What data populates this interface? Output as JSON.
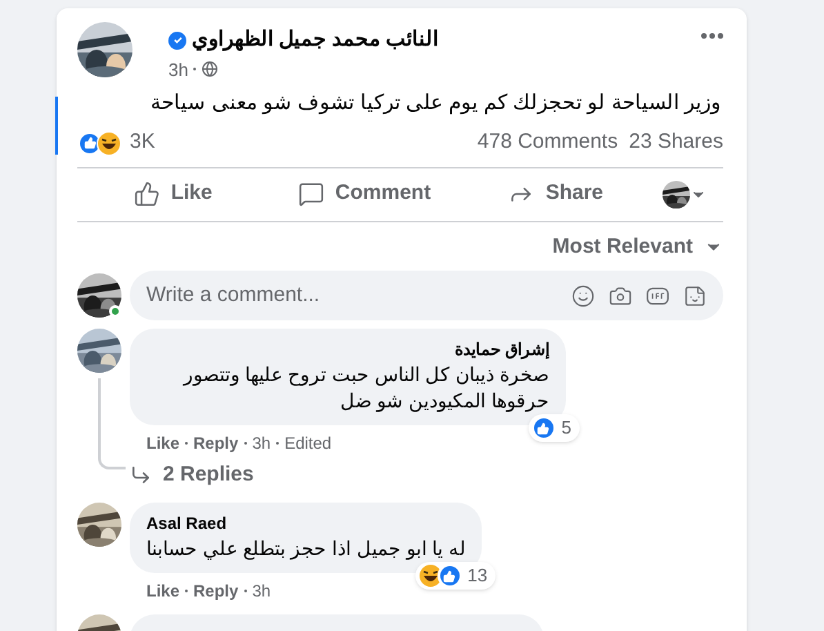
{
  "post": {
    "author": "النائب محمد جميل الظهراوي",
    "verified": true,
    "time": "3h",
    "text": "وزير السياحة  لو تحجزلك كم يوم على تركيا تشوف شو معنى سياحة",
    "reactions": [
      {
        "kind": "like"
      },
      {
        "kind": "haha"
      }
    ],
    "reaction_count": "3K",
    "comments_count": "478 Comments",
    "shares_count": "23 Shares"
  },
  "actions": [
    {
      "kind": "like",
      "label": "Like"
    },
    {
      "kind": "comment",
      "label": "Comment"
    },
    {
      "kind": "share",
      "label": "Share"
    }
  ],
  "sort": {
    "label": "Most Relevant"
  },
  "composer": {
    "placeholder": "Write a comment...",
    "online": true
  },
  "comments": [
    {
      "name": "إشراق حمايدة",
      "text": "صخرة ذيبان كل الناس حبت تروح عليها وتتصور حرقوها المكيودين شو ضل",
      "reactions": [
        {
          "kind": "like"
        }
      ],
      "reaction_count": "5",
      "like": "Like",
      "reply": "Reply",
      "time": "3h",
      "edited": "Edited",
      "replies": "2 Replies"
    },
    {
      "name": "Asal Raed",
      "text": "له يا ابو جميل اذا حجز بتطلع علي حسابنا",
      "reactions": [
        {
          "kind": "haha"
        },
        {
          "kind": "like"
        }
      ],
      "reaction_count": "13",
      "like": "Like",
      "reply": "Reply",
      "time": "3h"
    },
    {
      "kind": "cut"
    }
  ]
}
